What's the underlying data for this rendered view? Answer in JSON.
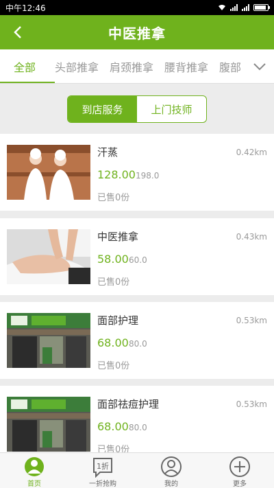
{
  "status_bar": {
    "time": "中午12:46"
  },
  "header": {
    "title": "中医推拿"
  },
  "categories": [
    "全部",
    "头部推拿",
    "肩颈推拿",
    "腰背推拿",
    "腹部"
  ],
  "segment": {
    "store": "到店服务",
    "home": "上门技师"
  },
  "items": [
    {
      "name": "汗蒸",
      "distance": "0.42km",
      "price": "128.00",
      "original": "198.0",
      "sold": "已售0份"
    },
    {
      "name": "中医推拿",
      "distance": "0.43km",
      "price": "58.00",
      "original": "60.0",
      "sold": "已售0份"
    },
    {
      "name": "面部护理",
      "distance": "0.53km",
      "price": "68.00",
      "original": "80.0",
      "sold": "已售0份"
    },
    {
      "name": "面部祛痘护理",
      "distance": "0.53km",
      "price": "68.00",
      "original": "80.0",
      "sold": "已售0份"
    }
  ],
  "tabs": [
    {
      "label": "首页",
      "icon": "home-icon"
    },
    {
      "label": "一折抢购",
      "icon": "discount-icon"
    },
    {
      "label": "我的",
      "icon": "user-icon"
    },
    {
      "label": "更多",
      "icon": "plus-icon"
    }
  ],
  "colors": {
    "brand": "#6fb21d",
    "muted": "#999999"
  }
}
